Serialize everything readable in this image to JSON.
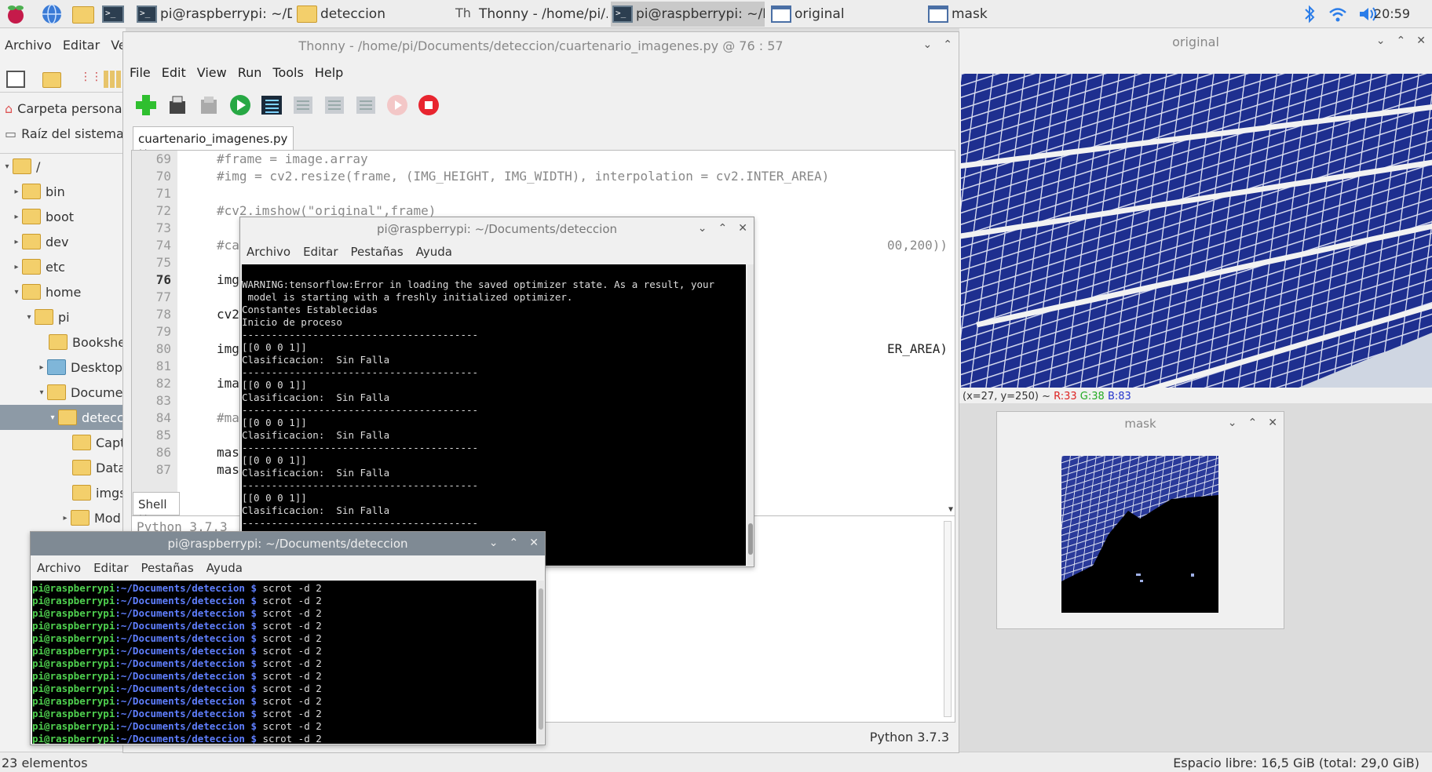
{
  "taskbar": {
    "tasks": [
      "pi@raspberrypi: ~/Do...",
      "deteccion",
      "Thonny  -  /home/pi/...",
      "pi@raspberrypi: ~/Do...",
      "original",
      "mask"
    ],
    "clock": "20:59"
  },
  "file_manager": {
    "menu": [
      "Archivo",
      "Editar",
      "Ver"
    ],
    "places": [
      "Carpeta personal",
      "Raíz del sistema"
    ],
    "tree": [
      "/",
      "bin",
      "boot",
      "dev",
      "etc",
      "home",
      "pi",
      "Bookshel",
      "Desktop",
      "Documer",
      "deteccio",
      "Capt",
      "Data",
      "imgs",
      "Mod"
    ],
    "status_left": "23 elementos",
    "status_right": "Espacio libre: 16,5 GiB (total: 29,0 GiB)"
  },
  "thonny": {
    "title": "Thonny  -  /home/pi/Documents/deteccion/cuartenario_imagenes.py  @  76 : 57",
    "menu": [
      "File",
      "Edit",
      "View",
      "Run",
      "Tools",
      "Help"
    ],
    "tab": "cuartenario_imagenes.py",
    "line_numbers": [
      "69",
      "70",
      "71",
      "72",
      "73",
      "74",
      "75",
      "76",
      "77",
      "78",
      "79",
      "80",
      "81",
      "82",
      "83",
      "84",
      "85",
      "86",
      "87"
    ],
    "code": {
      "l69": "#frame = image.array",
      "l70": "#img = cv2.resize(frame, (IMG_HEIGHT, IMG_WIDTH), interpolation = cv2.INTER_AREA)",
      "l72": "#cv2.imshow(\"original\",frame)",
      "l74": "#cam",
      "l74b": "00,200))",
      "l76": "img",
      "l78": "cv2.",
      "l80": "img",
      "l80b": "ER_AREA)",
      "l82": "imag",
      "l84": "#mas",
      "l86": "mask",
      "l87": "mask"
    },
    "shell_tab": "Shell",
    "shell_text": "Python 3.7.3",
    "python_version": "Python 3.7.3"
  },
  "terminal1": {
    "title": "pi@raspberrypi: ~/Documents/deteccion",
    "menu": [
      "Archivo",
      "Editar",
      "Pestañas",
      "Ayuda"
    ],
    "warning1": "WARNING:tensorflow:Error in loading the saved optimizer state. As a result, your",
    "warning2": " model is starting with a freshly initialized optimizer.",
    "l1": "Constantes Establecidas",
    "l2": "Inicio de proceso",
    "sep": "----------------------------------------",
    "arr": "[[0 0 0 1]]",
    "clas": "Clasificacion:  Sin Falla"
  },
  "terminal2": {
    "title": "pi@raspberrypi: ~/Documents/deteccion",
    "menu": [
      "Archivo",
      "Editar",
      "Pestañas",
      "Ayuda"
    ],
    "user": "pi@raspberrypi",
    "path": ":~/Documents/deteccion $",
    "cmd": " scrot -d 2"
  },
  "original": {
    "title": "original",
    "info_prefix": "(x=27, y=250) ~ ",
    "r": "R:33",
    "g": "G:38",
    "b": "B:83"
  },
  "mask": {
    "title": "mask"
  }
}
